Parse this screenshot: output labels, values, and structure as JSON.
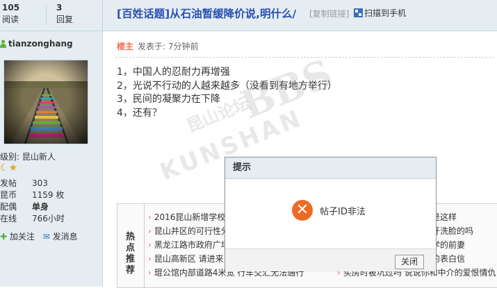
{
  "stats": {
    "views_num": "105",
    "views_label": "阅读",
    "replies_num": "3",
    "replies_label": "回复"
  },
  "thread": {
    "title": "[百姓话题]从石油暂缓降价说,明什么/",
    "copy_link": "[复制链接]",
    "qr_label": "扫描到手机"
  },
  "user": {
    "name": "tianzonghang",
    "level": "级别: 昆山新人",
    "info": [
      {
        "k": "发帖",
        "v": "303"
      },
      {
        "k": "昆币",
        "v": "1159 枚"
      },
      {
        "k": "配偶",
        "v": "单身"
      },
      {
        "k": "在线",
        "v": "766小时"
      }
    ],
    "follow": "加关注",
    "message": "发消息"
  },
  "post": {
    "owner": "楼主",
    "posted": "发表于: 7分钟前",
    "lines": [
      "1，中国人的忍耐力再增强",
      "2，光说不行动的人越来越多（没看到有地方举行）",
      "3，民间的凝聚力在下降",
      "4，还有？"
    ]
  },
  "watermark": {
    "cn": "昆山论坛",
    "bbs": "BBS",
    "en": "KUNSHAN"
  },
  "related": {
    "title": "热点推荐",
    "left": [
      "2016昆山新增学校",
      "昆山并区的可行性分",
      "黑龙江路市政府广场",
      "昆山高新区 请进来",
      "琨公馆内部道路4米宽 行车交汇无法通行"
    ],
    "right": [
      "会是这样",
      "刷牙洗脸的吗",
      "同学的前妻",
      "子的表白信",
      "买房时被坑过吗 说说你和中介的爱恨情仇"
    ]
  },
  "dialog": {
    "title": "提示",
    "message": "帖子ID非法",
    "close": "关闭"
  },
  "colors": {
    "title": "#2a4fb0",
    "accent": "#f26c4f",
    "panel": "#e5edf2",
    "error": "#ef6a27"
  }
}
